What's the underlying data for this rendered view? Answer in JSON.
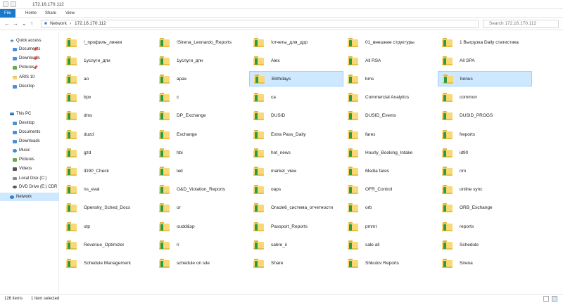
{
  "window": {
    "title": "172.16.170.112"
  },
  "ribbon": {
    "tabs": [
      "File",
      "Home",
      "Share",
      "View"
    ]
  },
  "address": {
    "back": "←",
    "forward": "→",
    "dropdown": "⌄",
    "up": "↑",
    "segments": [
      "Network",
      "172.16.170.112"
    ],
    "separator": "›",
    "search_placeholder": "Search 172.16.170.112"
  },
  "sidebar": {
    "items": [
      {
        "label": "Quick access",
        "icon": "star-icon"
      },
      {
        "label": "Documents",
        "icon": "documents-icon",
        "pinned": true
      },
      {
        "label": "Downloads",
        "icon": "downloads-icon",
        "pinned": true
      },
      {
        "label": "Pictures",
        "icon": "pictures-icon",
        "pinned": true
      },
      {
        "label": "ARIS 10",
        "icon": "folder-icon"
      },
      {
        "label": "Desktop",
        "icon": "desktop-icon"
      },
      {
        "label": "This PC",
        "icon": "pc-icon"
      },
      {
        "label": "Desktop",
        "icon": "desktop-icon"
      },
      {
        "label": "Documents",
        "icon": "documents-icon"
      },
      {
        "label": "Downloads",
        "icon": "downloads-icon"
      },
      {
        "label": "Music",
        "icon": "music-icon"
      },
      {
        "label": "Pictures",
        "icon": "pictures-icon"
      },
      {
        "label": "Videos",
        "icon": "videos-icon"
      },
      {
        "label": "Local Disk (C:)",
        "icon": "disk-icon"
      },
      {
        "label": "DVD Drive (E:) CDR",
        "icon": "dvd-icon"
      },
      {
        "label": "Network",
        "icon": "network-icon",
        "selected": true
      }
    ],
    "pin_glyph": "📌"
  },
  "folders": [
    "!_профиль_линии",
    "!Sirena_Leonardo_Reports",
    "!отчеты_для_дрр",
    "01_внешние структуры",
    "1 Выгрузка Daily статистика",
    "1услуги_дпи",
    "1услуги_дпн",
    "Alex",
    "All RSA",
    "All SPA",
    "ao",
    "apax",
    "Birthdays",
    "bms",
    "bonus",
    "bpx",
    "c",
    "ca",
    "Commercial Analytics",
    "common",
    "dms",
    "DP_Exchange",
    "DUSID",
    "DUSID_Events",
    "DUSID_PROGS",
    "duzd",
    "Exchange",
    "Extra Pass_Daily",
    "fares",
    "freports",
    "gzd",
    "hbi",
    "hot_news",
    "Hourly_Booking_Intake",
    "id90",
    "ID90_Check",
    "led",
    "market_view",
    "Media fares",
    "nm",
    "ns_eval",
    "O&D_Violation_Reports",
    "oaps",
    "OFR_Control",
    "online sync",
    "Opensky_Sched_Docs",
    "or",
    "Oracle6_система_отчетности",
    "orb",
    "ORB_Exchange",
    "otp",
    "oudd&sp",
    "Passport_Reports",
    "pmmt",
    "reports",
    "Revenue_Optimizer",
    "ri",
    "sabre_ir",
    "sale all",
    "Schedule",
    "Schedule Management",
    "schedule on site",
    "Share",
    "Shkutov Reports",
    "Sirena"
  ],
  "selected": [
    "Birthdays",
    "bonus"
  ],
  "status": {
    "count": "126 items",
    "selection": "1 item selected"
  },
  "colors": {
    "accent": "#1979ca",
    "selection": "#cde8ff",
    "folder": "#f8d877"
  }
}
